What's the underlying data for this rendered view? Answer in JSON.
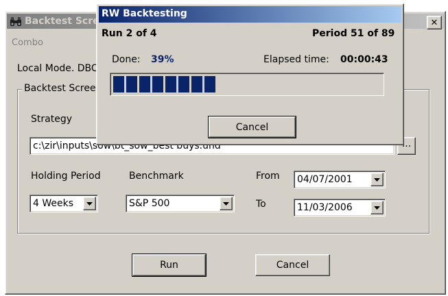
{
  "colors": {
    "face": "#d4d0c8",
    "title_active_start": "#0a246a",
    "title_active_end": "#a6caf0",
    "progress_block": "#0a246a",
    "percent_text": "#0a246a"
  },
  "main_window": {
    "title": "Backtest Scre",
    "icon": "binoculars-icon",
    "close_label": "✕",
    "menu": [
      "Combo"
    ],
    "mode_text": "Local Mode. DBC",
    "group_label": "Backtest Screen",
    "strategy": {
      "label": "Strategy",
      "value": "c:\\zir\\inputs\\sow\\bt_sow_best buys.und",
      "browse_label": "..."
    },
    "holding_period": {
      "label": "Holding Period",
      "value": "4 Weeks"
    },
    "benchmark": {
      "label": "Benchmark",
      "value": "S&P 500"
    },
    "from": {
      "label": "From",
      "value": "04/07/2001"
    },
    "to": {
      "label": "To",
      "value": "11/03/2006"
    },
    "run_button": "Run",
    "cancel_button": "Cancel"
  },
  "progress_dialog": {
    "title": "RW Backtesting",
    "run_text": "Run 2 of 4",
    "period_text": "Period 51 of 89",
    "done_label": "Done:",
    "done_value": "39%",
    "elapsed_label": "Elapsed time:",
    "elapsed_value": "00:00:43",
    "progress_fraction": 0.39,
    "progress_blocks_filled": 8,
    "cancel_button": "Cancel"
  }
}
